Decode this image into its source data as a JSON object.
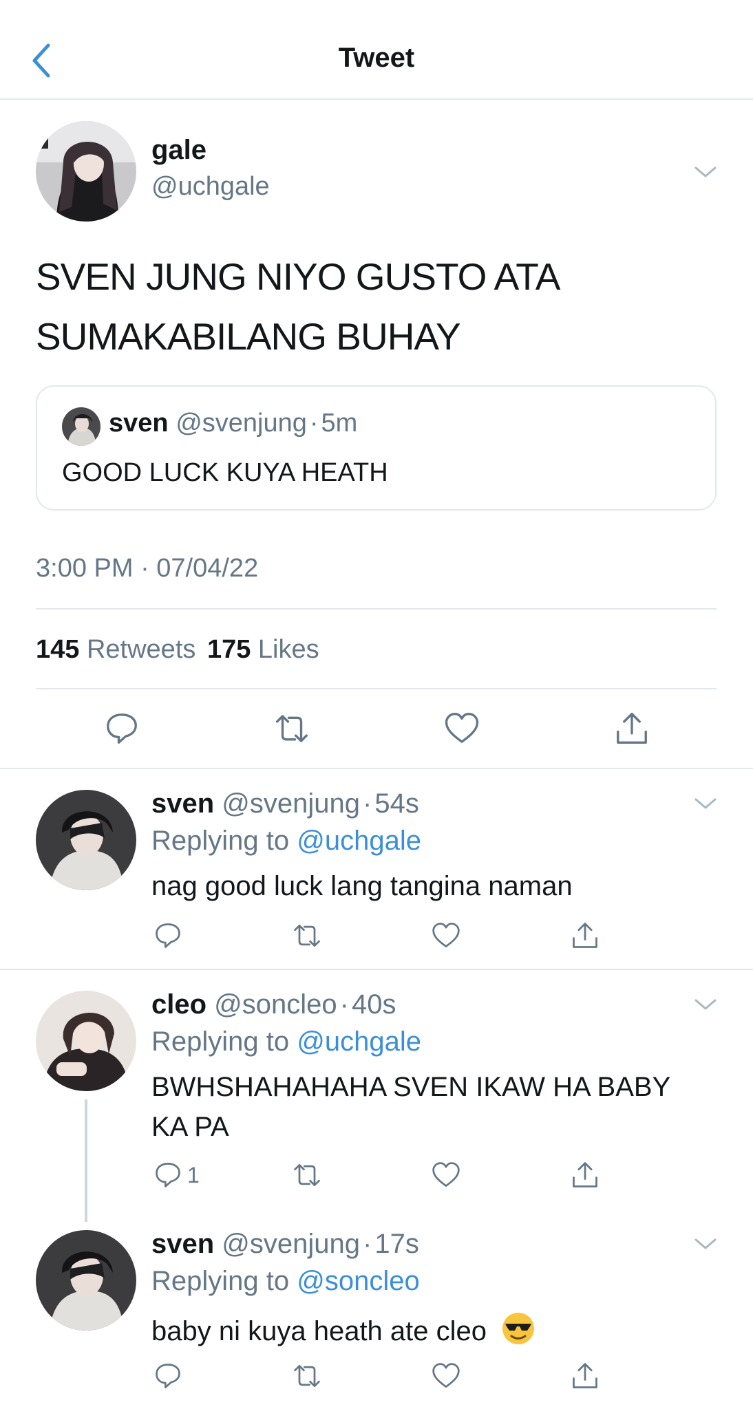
{
  "header": {
    "title": "Tweet",
    "back_icon": "chevron-left-icon"
  },
  "main_tweet": {
    "display_name": "gale",
    "handle": "@uchgale",
    "text_line1": "SVEN JUNG NIYO GUSTO ATA",
    "text_line2": "SUMAKABILANG BUHAY",
    "quote": {
      "display_name": "sven",
      "handle": "@svenjung",
      "sep": "·",
      "time": "5m",
      "text": "GOOD LUCK KUYA HEATH"
    },
    "timestamp": "3:00 PM · 07/04/22",
    "retweets_count": "145",
    "retweets_label": "Retweets",
    "likes_count": "175",
    "likes_label": "Likes"
  },
  "replies": [
    {
      "display_name": "sven",
      "handle": "@svenjung",
      "sep": "·",
      "time": "54s",
      "replying_label": "Replying to",
      "replying_to": "@uchgale",
      "text_line1": "nag good luck lang tangina naman",
      "text_line2": "",
      "reply_count": ""
    },
    {
      "display_name": "cleo",
      "handle": "@soncleo",
      "sep": "·",
      "time": "40s",
      "replying_label": "Replying to",
      "replying_to": "@uchgale",
      "text_line1": "BWHSHAHAHAHA SVEN IKAW HA BABY",
      "text_line2": "KA PA",
      "reply_count": "1"
    },
    {
      "display_name": "sven",
      "handle": "@svenjung",
      "sep": "·",
      "time": "17s",
      "replying_label": "Replying to",
      "replying_to": "@soncleo",
      "text_line1": "baby ni kuya heath ate cleo",
      "text_line2": "",
      "reply_count": ""
    }
  ],
  "colors": {
    "accent": "#3b8fd9",
    "secondary_text": "#657786",
    "divider": "#e1e8ed",
    "icon": "#657786"
  },
  "icons": [
    "chevron-left-icon",
    "chevron-down-icon",
    "reply-icon",
    "retweet-icon",
    "like-icon",
    "share-icon",
    "sunglasses-emoji"
  ]
}
